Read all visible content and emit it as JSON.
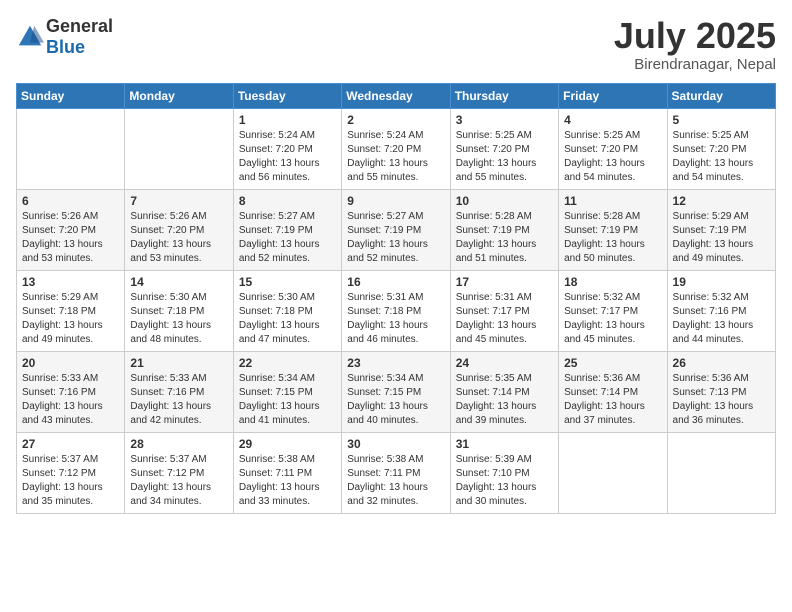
{
  "header": {
    "logo_general": "General",
    "logo_blue": "Blue",
    "month": "July 2025",
    "location": "Birendranagar, Nepal"
  },
  "weekdays": [
    "Sunday",
    "Monday",
    "Tuesday",
    "Wednesday",
    "Thursday",
    "Friday",
    "Saturday"
  ],
  "weeks": [
    [
      {
        "day": "",
        "info": ""
      },
      {
        "day": "",
        "info": ""
      },
      {
        "day": "1",
        "info": "Sunrise: 5:24 AM\nSunset: 7:20 PM\nDaylight: 13 hours and 56 minutes."
      },
      {
        "day": "2",
        "info": "Sunrise: 5:24 AM\nSunset: 7:20 PM\nDaylight: 13 hours and 55 minutes."
      },
      {
        "day": "3",
        "info": "Sunrise: 5:25 AM\nSunset: 7:20 PM\nDaylight: 13 hours and 55 minutes."
      },
      {
        "day": "4",
        "info": "Sunrise: 5:25 AM\nSunset: 7:20 PM\nDaylight: 13 hours and 54 minutes."
      },
      {
        "day": "5",
        "info": "Sunrise: 5:25 AM\nSunset: 7:20 PM\nDaylight: 13 hours and 54 minutes."
      }
    ],
    [
      {
        "day": "6",
        "info": "Sunrise: 5:26 AM\nSunset: 7:20 PM\nDaylight: 13 hours and 53 minutes."
      },
      {
        "day": "7",
        "info": "Sunrise: 5:26 AM\nSunset: 7:20 PM\nDaylight: 13 hours and 53 minutes."
      },
      {
        "day": "8",
        "info": "Sunrise: 5:27 AM\nSunset: 7:19 PM\nDaylight: 13 hours and 52 minutes."
      },
      {
        "day": "9",
        "info": "Sunrise: 5:27 AM\nSunset: 7:19 PM\nDaylight: 13 hours and 52 minutes."
      },
      {
        "day": "10",
        "info": "Sunrise: 5:28 AM\nSunset: 7:19 PM\nDaylight: 13 hours and 51 minutes."
      },
      {
        "day": "11",
        "info": "Sunrise: 5:28 AM\nSunset: 7:19 PM\nDaylight: 13 hours and 50 minutes."
      },
      {
        "day": "12",
        "info": "Sunrise: 5:29 AM\nSunset: 7:19 PM\nDaylight: 13 hours and 49 minutes."
      }
    ],
    [
      {
        "day": "13",
        "info": "Sunrise: 5:29 AM\nSunset: 7:18 PM\nDaylight: 13 hours and 49 minutes."
      },
      {
        "day": "14",
        "info": "Sunrise: 5:30 AM\nSunset: 7:18 PM\nDaylight: 13 hours and 48 minutes."
      },
      {
        "day": "15",
        "info": "Sunrise: 5:30 AM\nSunset: 7:18 PM\nDaylight: 13 hours and 47 minutes."
      },
      {
        "day": "16",
        "info": "Sunrise: 5:31 AM\nSunset: 7:18 PM\nDaylight: 13 hours and 46 minutes."
      },
      {
        "day": "17",
        "info": "Sunrise: 5:31 AM\nSunset: 7:17 PM\nDaylight: 13 hours and 45 minutes."
      },
      {
        "day": "18",
        "info": "Sunrise: 5:32 AM\nSunset: 7:17 PM\nDaylight: 13 hours and 45 minutes."
      },
      {
        "day": "19",
        "info": "Sunrise: 5:32 AM\nSunset: 7:16 PM\nDaylight: 13 hours and 44 minutes."
      }
    ],
    [
      {
        "day": "20",
        "info": "Sunrise: 5:33 AM\nSunset: 7:16 PM\nDaylight: 13 hours and 43 minutes."
      },
      {
        "day": "21",
        "info": "Sunrise: 5:33 AM\nSunset: 7:16 PM\nDaylight: 13 hours and 42 minutes."
      },
      {
        "day": "22",
        "info": "Sunrise: 5:34 AM\nSunset: 7:15 PM\nDaylight: 13 hours and 41 minutes."
      },
      {
        "day": "23",
        "info": "Sunrise: 5:34 AM\nSunset: 7:15 PM\nDaylight: 13 hours and 40 minutes."
      },
      {
        "day": "24",
        "info": "Sunrise: 5:35 AM\nSunset: 7:14 PM\nDaylight: 13 hours and 39 minutes."
      },
      {
        "day": "25",
        "info": "Sunrise: 5:36 AM\nSunset: 7:14 PM\nDaylight: 13 hours and 37 minutes."
      },
      {
        "day": "26",
        "info": "Sunrise: 5:36 AM\nSunset: 7:13 PM\nDaylight: 13 hours and 36 minutes."
      }
    ],
    [
      {
        "day": "27",
        "info": "Sunrise: 5:37 AM\nSunset: 7:12 PM\nDaylight: 13 hours and 35 minutes."
      },
      {
        "day": "28",
        "info": "Sunrise: 5:37 AM\nSunset: 7:12 PM\nDaylight: 13 hours and 34 minutes."
      },
      {
        "day": "29",
        "info": "Sunrise: 5:38 AM\nSunset: 7:11 PM\nDaylight: 13 hours and 33 minutes."
      },
      {
        "day": "30",
        "info": "Sunrise: 5:38 AM\nSunset: 7:11 PM\nDaylight: 13 hours and 32 minutes."
      },
      {
        "day": "31",
        "info": "Sunrise: 5:39 AM\nSunset: 7:10 PM\nDaylight: 13 hours and 30 minutes."
      },
      {
        "day": "",
        "info": ""
      },
      {
        "day": "",
        "info": ""
      }
    ]
  ]
}
